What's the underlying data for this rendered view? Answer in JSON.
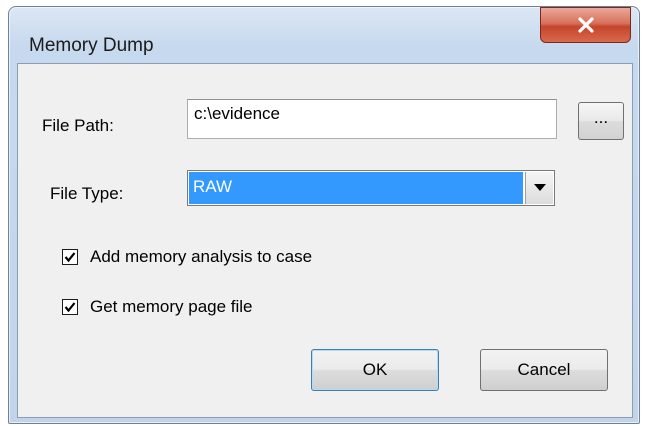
{
  "window": {
    "title": "Memory Dump",
    "close_icon": "close-icon"
  },
  "form": {
    "file_path_label": "File Path:",
    "file_path_value": "c:\\evidence",
    "browse_label": "...",
    "file_type_label": "File Type:",
    "file_type_value": "RAW",
    "dropdown_icon": "chevron-down-icon"
  },
  "options": [
    {
      "label": "Add memory analysis to case",
      "checked": true
    },
    {
      "label": "Get memory page file",
      "checked": true
    }
  ],
  "buttons": {
    "ok_label": "OK",
    "cancel_label": "Cancel"
  },
  "colors": {
    "selection": "#3399ff",
    "close_button": "#c4452a",
    "title_bar": "#c7d9ee"
  }
}
